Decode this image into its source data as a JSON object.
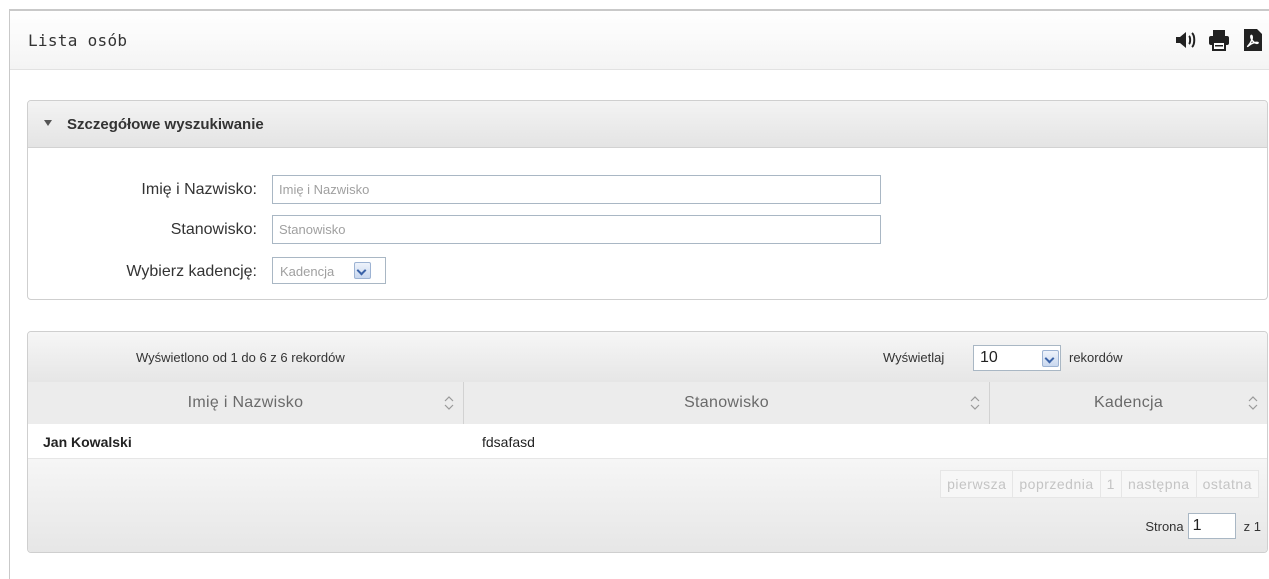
{
  "header": {
    "title": "Lista osób",
    "icons": [
      "speaker-icon",
      "printer-icon",
      "pdf-icon"
    ]
  },
  "search": {
    "title": "Szczegółowe wyszukiwanie",
    "name_label": "Imię i Nazwisko:",
    "name_placeholder": "Imię i Nazwisko",
    "position_label": "Stanowisko:",
    "position_placeholder": "Stanowisko",
    "term_label": "Wybierz kadencję:",
    "term_selected": "Kadencja"
  },
  "table": {
    "info": "Wyświetlono od 1 do 6 z 6 rekordów",
    "length_label": "Wyświetlaj",
    "length_value": "10",
    "length_after": "rekordów",
    "columns": [
      "Imię i Nazwisko",
      "Stanowisko",
      "Kadencja"
    ],
    "rows": [
      {
        "name": "Jan Kowalski",
        "position": "fdsafasd",
        "term": ""
      }
    ]
  },
  "pagination": {
    "first": "pierwsza",
    "previous": "poprzednia",
    "page": "1",
    "next": "następna",
    "last": "ostatna",
    "page_label": "Strona",
    "current_page": "1",
    "of_total": "z 1"
  },
  "colors": {
    "accent_dropdown": "#3b63a8",
    "header_bg": "#ececec"
  }
}
